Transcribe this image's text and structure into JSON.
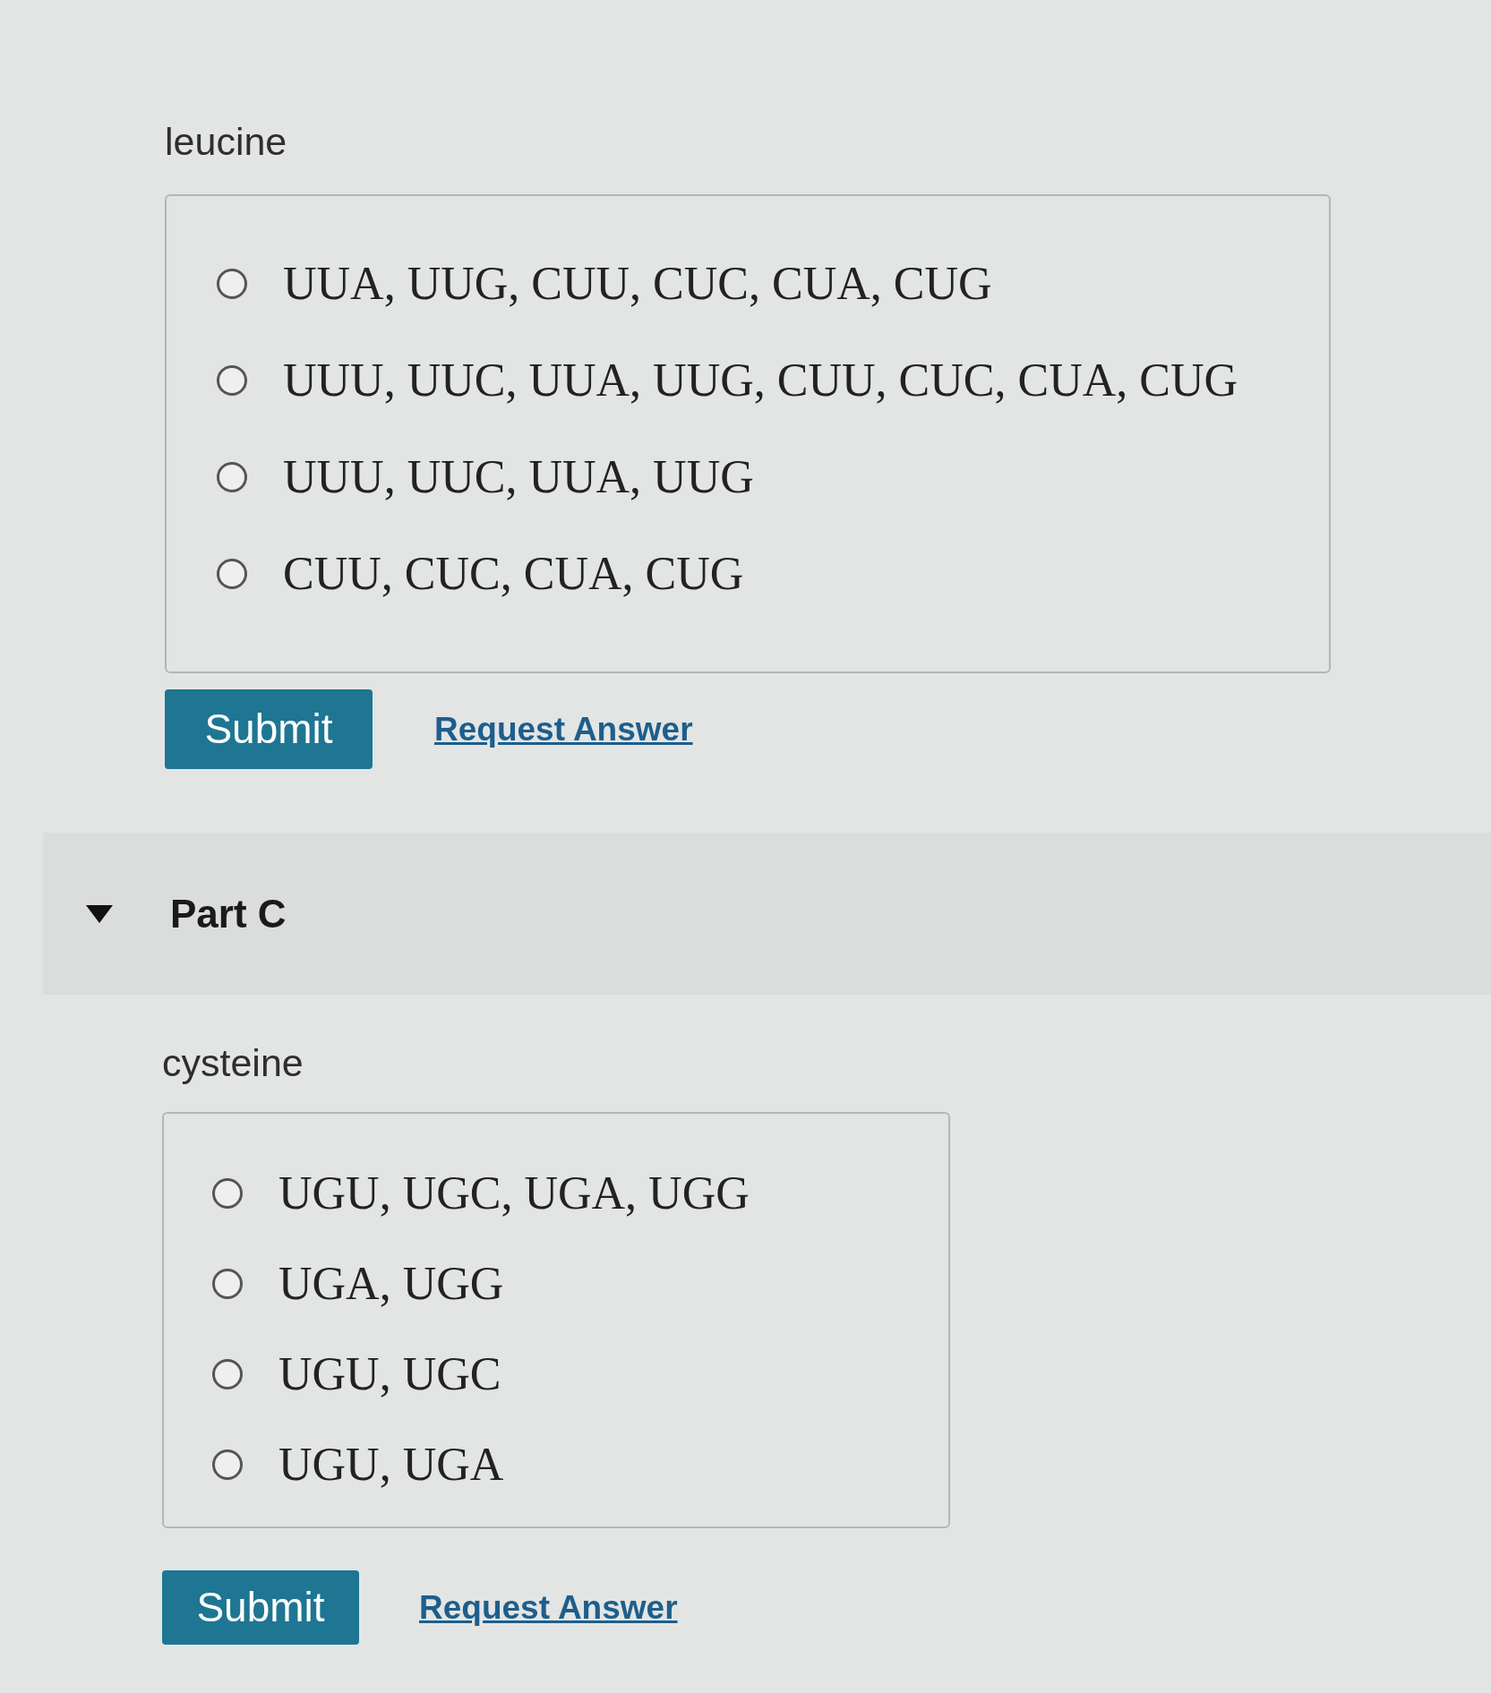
{
  "sections": [
    {
      "prompt": "leucine",
      "options": [
        {
          "label": "UUA, UUG, CUU, CUC, CUA, CUG",
          "selected": false
        },
        {
          "label": "UUU, UUC, UUA, UUG, CUU, CUC, CUA, CUG",
          "selected": false
        },
        {
          "label": "UUU, UUC, UUA, UUG",
          "selected": false
        },
        {
          "label": "CUU, CUC, CUA, CUG",
          "selected": false
        }
      ],
      "submit": "Submit",
      "request_answer": "Request Answer"
    },
    {
      "header": {
        "title": "Part C",
        "expanded": true
      },
      "prompt": "cysteine",
      "options": [
        {
          "label": "UGU, UGC, UGA, UGG",
          "selected": false
        },
        {
          "label": "UGA, UGG",
          "selected": false
        },
        {
          "label": "UGU, UGC",
          "selected": false
        },
        {
          "label": "UGU, UGA",
          "selected": false
        }
      ],
      "submit": "Submit",
      "request_answer": "Request Answer"
    }
  ]
}
